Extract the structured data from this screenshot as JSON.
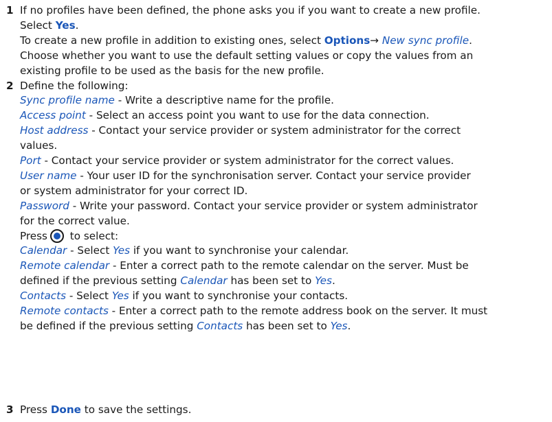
{
  "steps": [
    {
      "number": "1",
      "line1": "If no profiles have been defined, the phone asks you if you want to create a new profile.",
      "line2_pre": "Select ",
      "line2_key": "Yes",
      "line2_post": ".",
      "line3_pre": "To create a new profile in addition to existing ones, select ",
      "line3_key": "Options",
      "line3_arrow": "→ ",
      "line3_item": "New sync profile",
      "line3_post": ".",
      "line4": "Choose whether you want to use the default setting values or copy the values from an",
      "line5": "existing profile to be used as the basis for the new profile."
    },
    {
      "number": "2",
      "intro": "Define the following:",
      "settings": {
        "sync_profile_name": {
          "term": "Sync profile name",
          "desc": " - Write a descriptive name for the profile."
        },
        "access_point": {
          "term": "Access point",
          "desc": " - Select an access point you want to use for the data connection."
        },
        "host_address": {
          "term": "Host address",
          "desc": " - Contact your service provider or system administrator for the correct",
          "desc2": "values."
        },
        "port": {
          "term": "Port",
          "desc": " - Contact your service provider or system administrator for the correct values."
        },
        "user_name": {
          "term": "User name",
          "desc": " - Your user ID for the synchronisation server. Contact your service provider",
          "desc2": "or system administrator for your correct ID."
        },
        "password": {
          "term": "Password",
          "desc": " - Write your password. Contact your service provider or system administrator",
          "desc2": "for the correct value."
        }
      },
      "press_pre": "Press",
      "press_post": " to select:",
      "select_items": {
        "calendar": {
          "term": "Calendar",
          "desc_pre": " - Select ",
          "desc_key": "Yes",
          "desc_post": " if you want to synchronise your calendar."
        },
        "remote_calendar": {
          "term": "Remote calendar",
          "desc": " - Enter a correct path to the remote calendar on the server. Must be",
          "desc2_pre": "defined if the previous setting ",
          "desc2_ref": "Calendar",
          "desc2_mid": " has been set to ",
          "desc2_key": "Yes",
          "desc2_post": "."
        },
        "contacts": {
          "term": "Contacts",
          "desc_pre": " - Select ",
          "desc_key": "Yes",
          "desc_post": " if you want to synchronise your contacts."
        },
        "remote_contacts": {
          "term": "Remote contacts",
          "desc": " - Enter a correct path to the remote address book on the server. It must",
          "desc2_pre": "be defined if the previous setting ",
          "desc2_ref": "Contacts",
          "desc2_mid": " has been set to ",
          "desc2_key": "Yes",
          "desc2_post": "."
        }
      }
    },
    {
      "number": "3",
      "pre": "Press ",
      "key": "Done",
      "post": " to save the settings."
    }
  ]
}
